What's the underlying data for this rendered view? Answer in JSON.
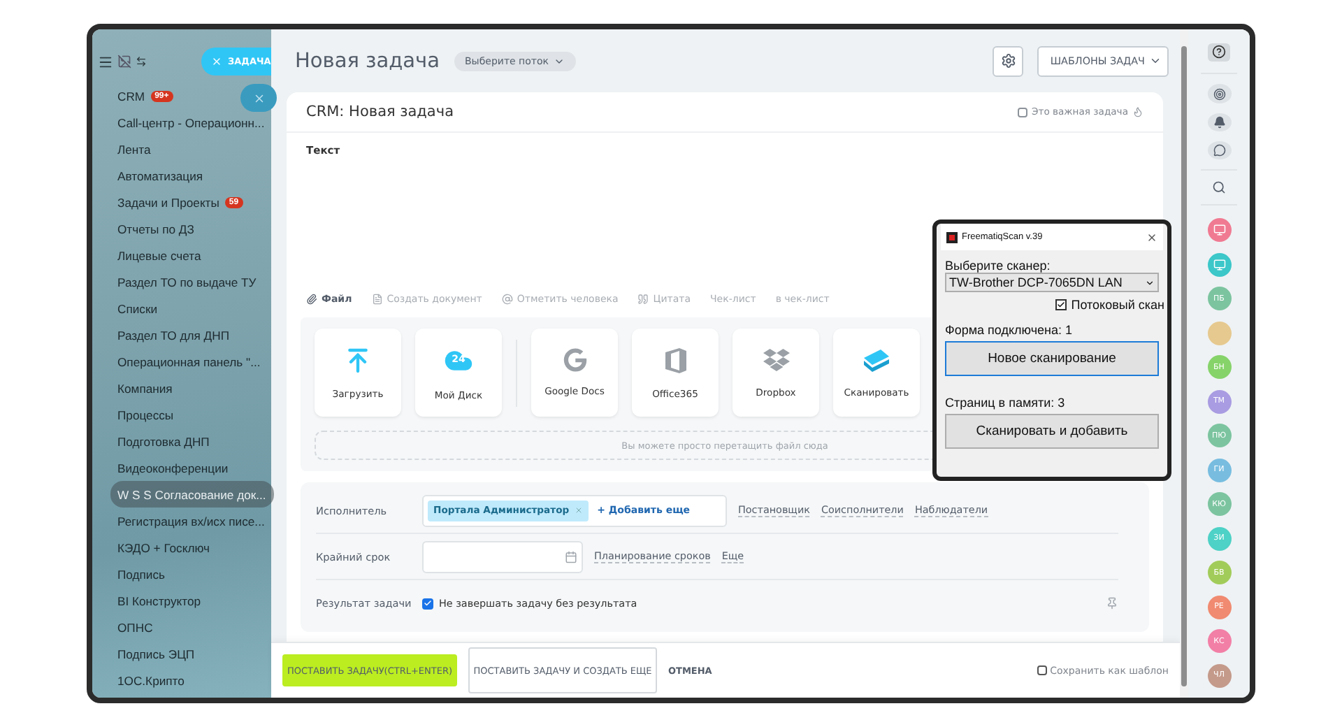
{
  "sidebar": {
    "create_button": "ЗАДАЧА",
    "items": [
      {
        "label": "CRM",
        "badge": "99+",
        "selected": false
      },
      {
        "label": "Call-центр - Операционн...",
        "selected": false
      },
      {
        "label": "Лента",
        "selected": false
      },
      {
        "label": "Автоматизация",
        "selected": false
      },
      {
        "label": "Задачи и Проекты",
        "badge": "59",
        "selected": false
      },
      {
        "label": "Отчеты по ДЗ",
        "selected": false
      },
      {
        "label": "Лицевые счета",
        "selected": false
      },
      {
        "label": "Раздел ТО по выдаче ТУ",
        "selected": false
      },
      {
        "label": "Списки",
        "selected": false
      },
      {
        "label": "Раздел ТО для ДНП",
        "selected": false
      },
      {
        "label": "Операционная панель \"...",
        "selected": false
      },
      {
        "label": "Компания",
        "selected": false
      },
      {
        "label": "Процессы",
        "selected": false
      },
      {
        "label": "Подготовка ДНП",
        "selected": false
      },
      {
        "label": "Видеоконференции",
        "selected": false
      },
      {
        "label": "W S S Согласование док...",
        "selected": true
      },
      {
        "label": "Регистрация вх/исх писе...",
        "selected": false
      },
      {
        "label": "КЭДО + Госключ",
        "selected": false
      },
      {
        "label": "Подпись",
        "selected": false
      },
      {
        "label": "BI Конструктор",
        "selected": false
      },
      {
        "label": "ОПНС",
        "selected": false
      },
      {
        "label": "Подпись ЭЦП",
        "selected": false
      },
      {
        "label": "1ОС.Крипто",
        "selected": false
      }
    ]
  },
  "header": {
    "title": "Новая задача",
    "flow_select": "Выберите поток",
    "templates_button": "ШАБЛОНЫ ЗАДАЧ"
  },
  "task": {
    "title": "CRM: Новая задача",
    "important": {
      "label": "Это важная задача",
      "checked": false
    },
    "editor_text": "Текст",
    "toolbar": [
      {
        "kind": "file",
        "label": "Файл"
      },
      {
        "kind": "document",
        "label": "Создать документ"
      },
      {
        "kind": "mention",
        "label": "Отметить человека"
      },
      {
        "kind": "quote",
        "label": "Цитата"
      },
      {
        "kind": "plain",
        "label": "Чек-лист"
      },
      {
        "kind": "plain",
        "label": "в чек-лист"
      }
    ],
    "tiles": [
      {
        "kind": "upload",
        "label": "Загрузить"
      },
      {
        "kind": "disk",
        "label": "Мой Диск",
        "icon_text": "24"
      },
      {
        "kind": "google",
        "label": "Google Docs"
      },
      {
        "kind": "office",
        "label": "Office365"
      },
      {
        "kind": "dropbox",
        "label": "Dropbox"
      },
      {
        "kind": "scan",
        "label": "Сканировать"
      }
    ],
    "drop_hint": "Вы можете просто перетащить файл сюда",
    "assignee": {
      "label": "Исполнитель",
      "tag": "Портала Администратор",
      "add_link": "+ Добавить еще",
      "links": [
        "Постановщик",
        "Соисполнители",
        "Наблюдатели"
      ]
    },
    "deadline": {
      "label": "Крайний срок",
      "links": [
        "Планирование сроков",
        "Еще"
      ]
    },
    "result": {
      "label": "Результат задачи",
      "checkbox": {
        "label": "Не завершать задачу без результата",
        "checked": true
      }
    }
  },
  "footer": {
    "primary": "ПОСТАВИТЬ ЗАДАЧУ(CTRL+ENTER)",
    "secondary": "ПОСТАВИТЬ ЗАДАЧУ И СОЗДАТЬ ЕЩЕ",
    "cancel": "ОТМЕНА",
    "save_template": {
      "label": "Сохранить как шаблон",
      "checked": false
    }
  },
  "scanner_dialog": {
    "title": "FreematiqScan v.39",
    "scanner_label": "Выберите сканер:",
    "scanner_value": "TW-Brother DCP-7065DN LAN",
    "stream": {
      "label": "Потоковый скан",
      "checked": true
    },
    "form_status": "Форма подключена: 1",
    "new_scan_button": "Новое сканирование",
    "pages_status": "Страниц в памяти: 3",
    "scan_add_button": "Сканировать и добавить"
  },
  "right_bar": {
    "avatars": [
      {
        "kind": "icon",
        "color": "#f07a92"
      },
      {
        "kind": "icon",
        "color": "#3cc7c9"
      },
      {
        "kind": "initials",
        "text": "ПБ",
        "color": "#7cc4a0"
      },
      {
        "kind": "photo"
      },
      {
        "kind": "initials",
        "text": "БН",
        "color": "#86d36a"
      },
      {
        "kind": "initials",
        "text": "ТМ",
        "color": "#a99ce2"
      },
      {
        "kind": "initials",
        "text": "ПЮ",
        "color": "#7cc4a0"
      },
      {
        "kind": "initials",
        "text": "ГИ",
        "color": "#78bde0"
      },
      {
        "kind": "initials",
        "text": "КЮ",
        "color": "#7cc4a0"
      },
      {
        "kind": "initials",
        "text": "ЗИ",
        "color": "#4ed1c6"
      },
      {
        "kind": "initials",
        "text": "БВ",
        "color": "#a2cc5a"
      },
      {
        "kind": "initials",
        "text": "РЕ",
        "color": "#f08a70"
      },
      {
        "kind": "initials",
        "text": "КС",
        "color": "#f27fa6"
      },
      {
        "kind": "initials",
        "text": "ЧЛ",
        "color": "#c49a8b"
      }
    ]
  }
}
